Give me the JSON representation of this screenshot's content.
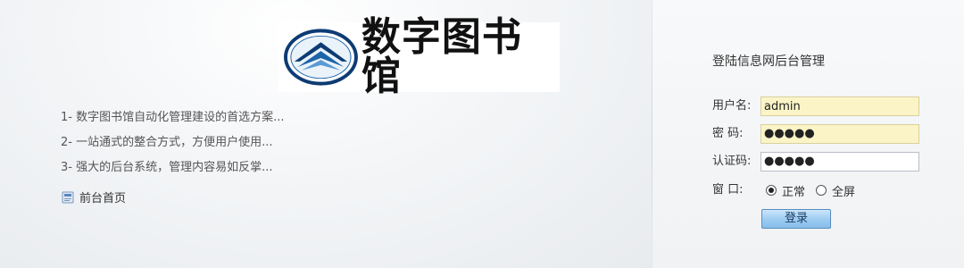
{
  "brand": {
    "logo_text": "数字图书馆",
    "colors": {
      "logo_blue": "#1d64a8",
      "logo_dark_blue": "#0d3b73",
      "autofill_yellow": "#fbf4c6",
      "button_blue": "#9fcdf2"
    }
  },
  "features": [
    "1- 数字图书馆自动化管理建设的首选方案...",
    "2- 一站通式的整合方式，方便用户使用...",
    "3- 强大的后台系统，管理内容易如反掌..."
  ],
  "home_link": {
    "label": "前台首页",
    "icon": "page-icon"
  },
  "login": {
    "title": "登陆信息网后台管理",
    "username_label": "用户名:",
    "username_value": "admin",
    "password_label": "密  码:",
    "password_value": "●●●●●",
    "captcha_label": "认证码:",
    "captcha_value": "●●●●●",
    "window_label": "窗  口:",
    "window_options": [
      "正常",
      "全屏"
    ],
    "window_selected": "正常",
    "submit_label": "登录"
  }
}
